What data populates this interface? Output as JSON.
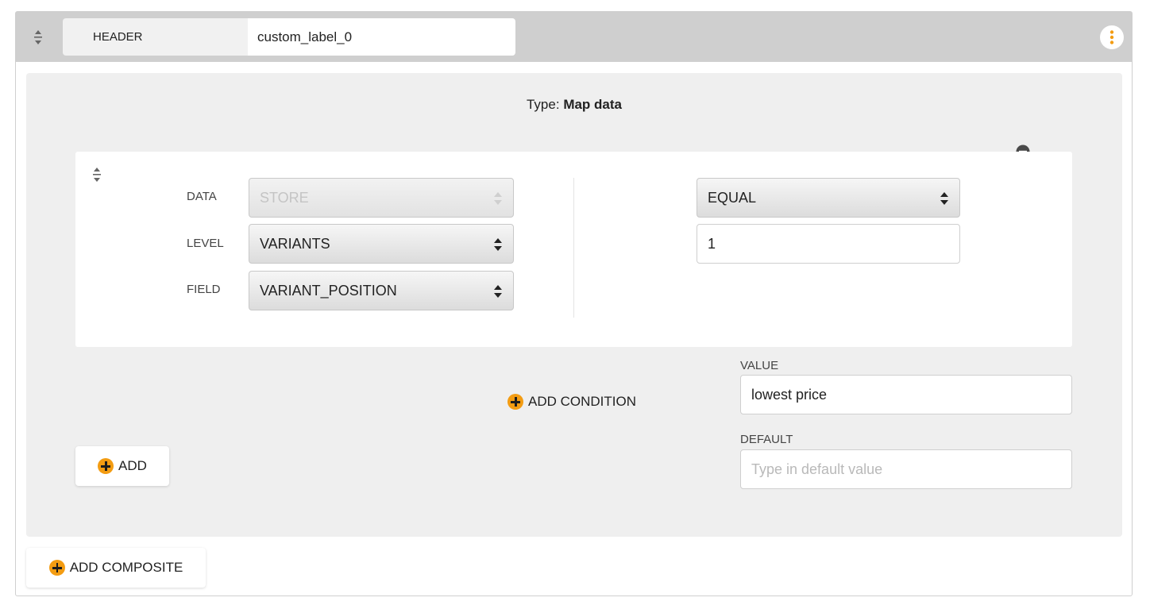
{
  "header": {
    "label": "HEADER",
    "name_value": "custom_label_0",
    "icons": {
      "drag": "drag-handle-icon",
      "menu": "kebab-menu-icon"
    },
    "menu_color": "#f39c12"
  },
  "composite": {
    "type_prefix": "Type:",
    "type_value": "Map data",
    "condition": {
      "data_label": "DATA",
      "data_value": "STORE",
      "level_label": "LEVEL",
      "level_value": "VARIANTS",
      "field_label": "FIELD",
      "field_value": "VARIANT_POSITION",
      "operator_value": "EQUAL",
      "compare_value": "1"
    },
    "add_condition_label": "ADD CONDITION",
    "value_label": "VALUE",
    "value_value": "lowest price",
    "default_label": "DEFAULT",
    "default_placeholder": "Type in default value",
    "add_label": "ADD"
  },
  "add_composite_label": "ADD COMPOSITE",
  "colors": {
    "accent": "#f39c12",
    "header_bg": "#cfcfcf",
    "panel_bg": "#efefef"
  }
}
